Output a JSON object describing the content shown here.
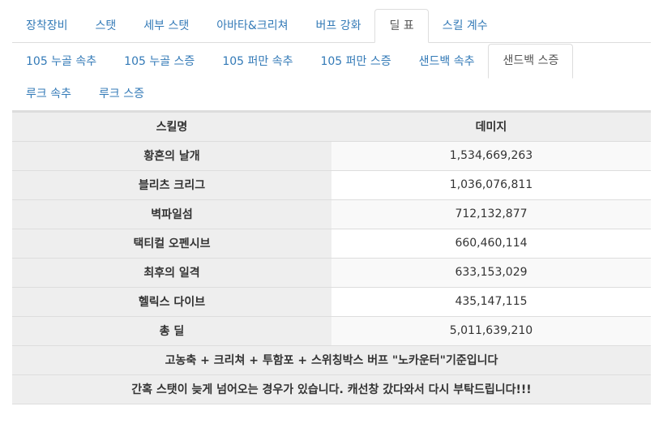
{
  "main_tabs": [
    {
      "label": "장착장비",
      "active": false
    },
    {
      "label": "스탯",
      "active": false
    },
    {
      "label": "세부 스탯",
      "active": false
    },
    {
      "label": "아바타&크리쳐",
      "active": false
    },
    {
      "label": "버프 강화",
      "active": false
    },
    {
      "label": "딜 표",
      "active": true
    },
    {
      "label": "스킬 계수",
      "active": false
    }
  ],
  "sub_tabs": [
    {
      "label": "105 누골 속추",
      "active": false
    },
    {
      "label": "105 누골 스증",
      "active": false
    },
    {
      "label": "105 퍼만 속추",
      "active": false
    },
    {
      "label": "105 퍼만 스증",
      "active": false
    },
    {
      "label": "샌드백 속추",
      "active": false
    },
    {
      "label": "샌드백 스증",
      "active": true
    },
    {
      "label": "루크 속추",
      "active": false
    },
    {
      "label": "루크 스증",
      "active": false
    }
  ],
  "table": {
    "headers": [
      "스킬명",
      "데미지"
    ],
    "rows": [
      {
        "skill": "황혼의 날개",
        "damage": "1,534,669,263"
      },
      {
        "skill": "블리츠 크리그",
        "damage": "1,036,076,811"
      },
      {
        "skill": "벽파일섬",
        "damage": "712,132,877"
      },
      {
        "skill": "택티컬 오펜시브",
        "damage": "660,460,114"
      },
      {
        "skill": "최후의 일격",
        "damage": "633,153,029"
      },
      {
        "skill": "헬릭스 다이브",
        "damage": "435,147,115"
      },
      {
        "skill": "총 딜",
        "damage": "5,011,639,210"
      }
    ],
    "notes": [
      "고농축 + 크리쳐 + 투함포 + 스위칭박스 버프 \"노카운터\"기준입니다",
      "간혹 스탯이 늦게 넘어오는 경우가 있습니다. 캐선창 갔다와서 다시 부탁드립니다!!!"
    ]
  }
}
